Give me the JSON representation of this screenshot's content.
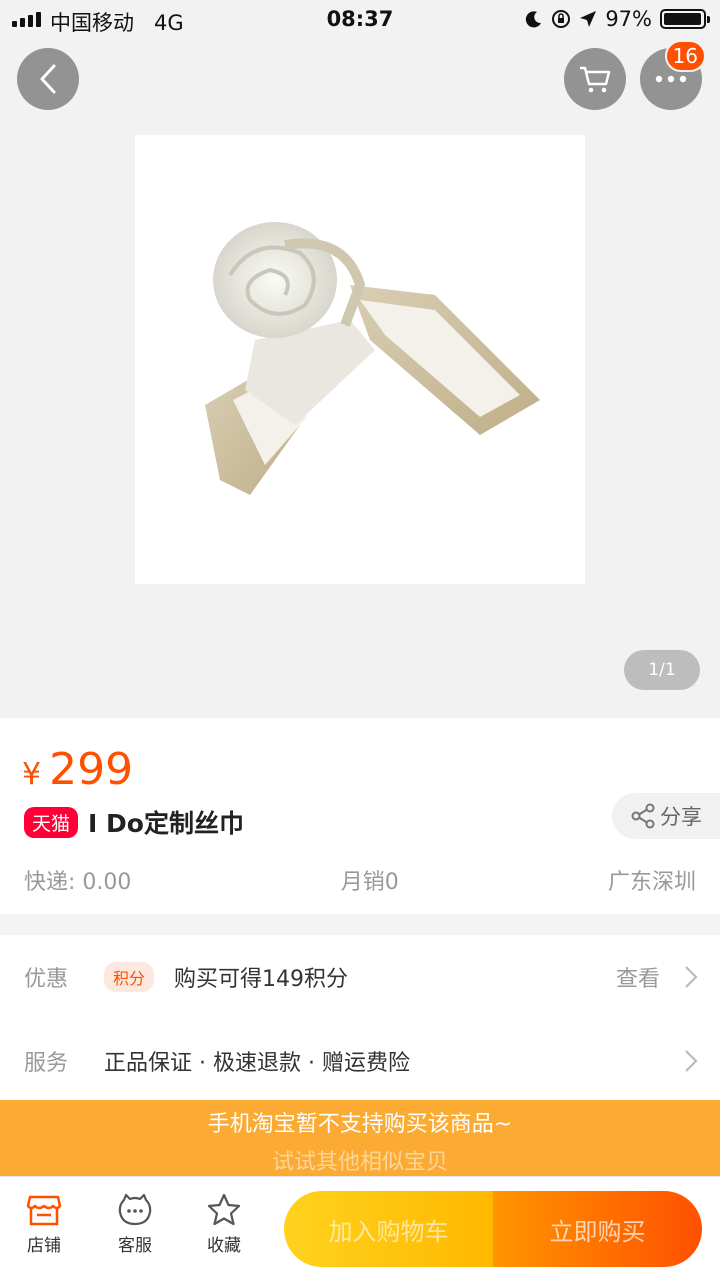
{
  "status_bar": {
    "carrier": "中国移动",
    "network": "4G",
    "time": "08:37",
    "battery": "97%",
    "battery_level": 0.97
  },
  "header": {
    "back_icon": "chevron-left-icon",
    "cart_icon": "cart-icon",
    "more_icon": "more-dots-icon",
    "more_badge": "16"
  },
  "gallery": {
    "pager": "1/1",
    "image_description_icon": "scarf-image"
  },
  "product": {
    "currency": "¥",
    "price": "299",
    "platform_badge": "天猫",
    "title": "I Do定制丝巾",
    "share_label": "分享",
    "shipping": "快递: 0.00",
    "monthly_sales": "月销0",
    "location": "广东深圳"
  },
  "promotions": {
    "label": "优惠",
    "points_tag": "积分",
    "points_text": "购买可得149积分",
    "view_label": "查看"
  },
  "services": {
    "label": "服务",
    "text": "正品保证 · 极速退款 · 赠运费险"
  },
  "notice": {
    "line1": "手机淘宝暂不支持购买该商品~",
    "line2": "试试其他相似宝贝"
  },
  "bottom_bar": {
    "tabs": [
      {
        "label": "店铺",
        "icon": "shop-icon"
      },
      {
        "label": "客服",
        "icon": "customer-service-icon"
      },
      {
        "label": "收藏",
        "icon": "star-icon"
      }
    ],
    "add_to_cart": "加入购物车",
    "buy_now": "立即购买"
  },
  "colors": {
    "accent": "#ff5000",
    "tmall_red": "#ff0036",
    "notice_bg": "#fbab34"
  }
}
